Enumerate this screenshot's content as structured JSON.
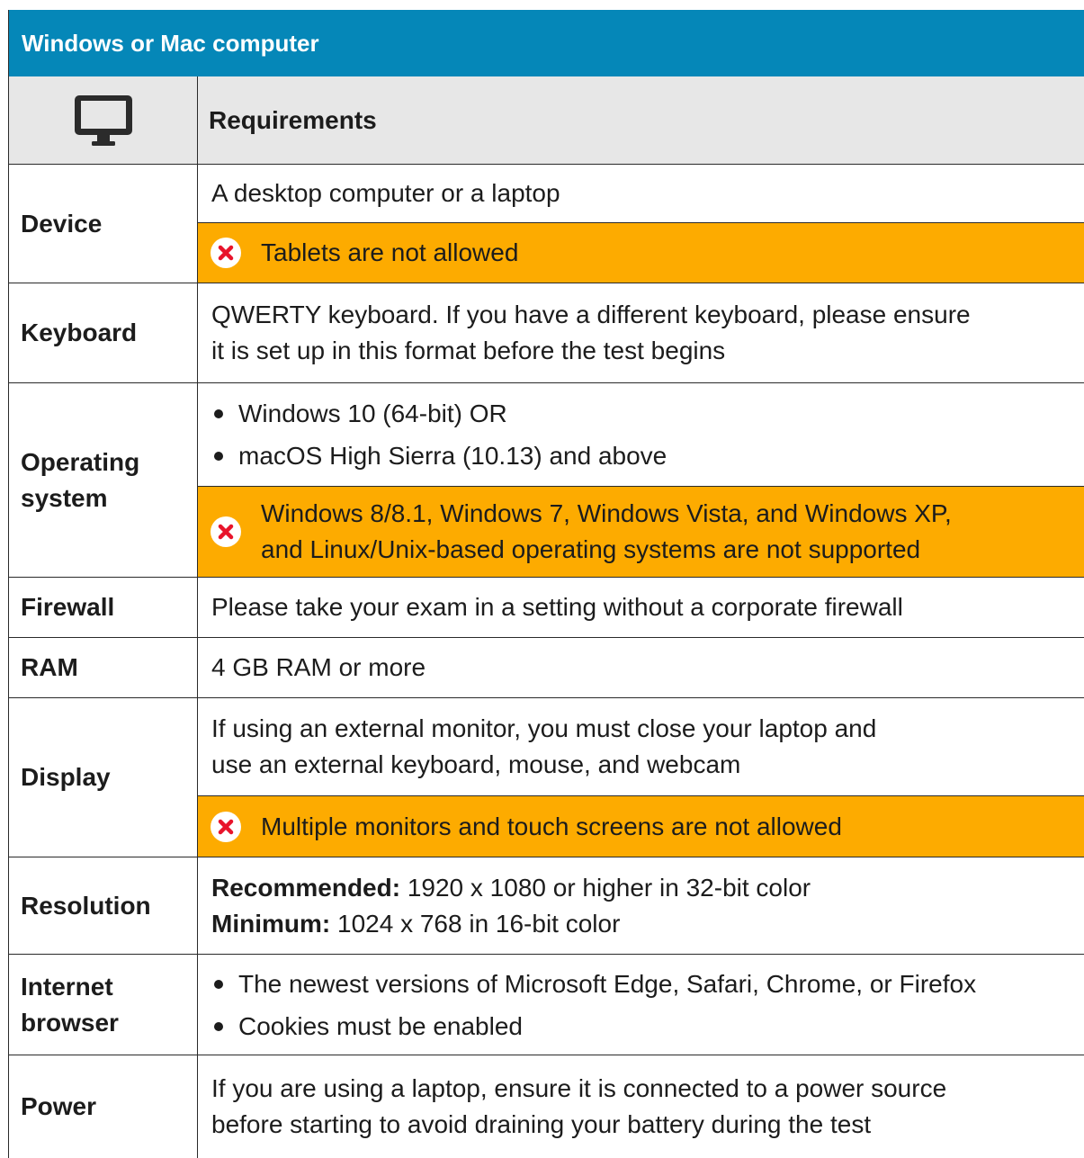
{
  "title": "Windows or Mac computer",
  "header": {
    "icon": "desktop-monitor-icon",
    "requirements_label": "Requirements"
  },
  "rows": {
    "device": {
      "label": "Device",
      "text": "A desktop computer or a laptop",
      "warning": "Tablets are not allowed"
    },
    "keyboard": {
      "label": "Keyboard",
      "line1": "QWERTY keyboard. If you have a different keyboard, please ensure",
      "line2": "it is set up in this format before the test begins"
    },
    "os": {
      "label1": "Operating",
      "label2": "system",
      "bullets": [
        "Windows 10 (64-bit) OR",
        "macOS High Sierra (10.13) and above"
      ],
      "warning_line1": "Windows 8/8.1, Windows 7, Windows Vista, and Windows XP,",
      "warning_line2": "and Linux/Unix-based operating systems are not supported"
    },
    "firewall": {
      "label": "Firewall",
      "text": "Please take your exam in a setting without a corporate firewall"
    },
    "ram": {
      "label": "RAM",
      "text": "4 GB RAM or more"
    },
    "display": {
      "label": "Display",
      "line1": "If using an external monitor, you must close your laptop and",
      "line2": "use an external keyboard, mouse, and webcam",
      "warning": "Multiple monitors and touch screens are not allowed"
    },
    "resolution": {
      "label": "Resolution",
      "recommended_label": "Recommended:",
      "recommended_value": " 1920 x 1080 or higher in 32-bit color",
      "minimum_label": "Minimum:",
      "minimum_value": " 1024 x 768 in 16-bit color"
    },
    "browser": {
      "label1": "Internet",
      "label2": "browser",
      "bullets": [
        "The newest versions of Microsoft Edge, Safari, Chrome, or Firefox",
        "Cookies must be enabled"
      ]
    },
    "power": {
      "label": "Power",
      "line1": "If you are using a laptop, ensure it is connected to a power source",
      "line2": "before starting to avoid draining your battery during the test"
    }
  },
  "colors": {
    "header_bg": "#0587b8",
    "warning_bg": "#fdab00",
    "header_row_bg": "#e7e7e7",
    "x_icon": "#e8142b"
  }
}
